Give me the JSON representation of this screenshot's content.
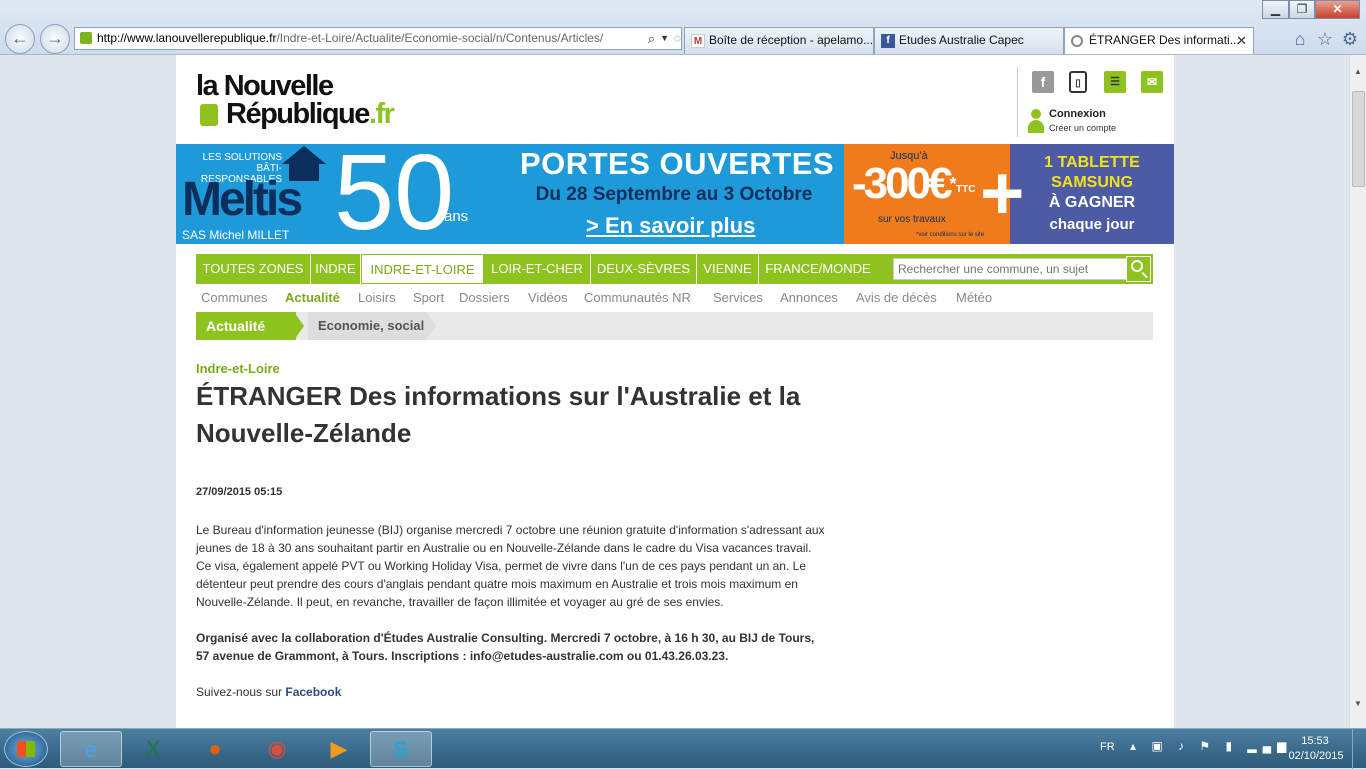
{
  "browser": {
    "address": {
      "host": "http://www.lanouvellerepublique.fr",
      "path": "/Indre-et-Loire/Actualite/Economie-social/n/Contenus/Articles/"
    },
    "tabs": [
      {
        "label": "Boîte de réception - apelamo...",
        "icon": "gmail-icon"
      },
      {
        "label": "Etudes Australie Capec",
        "icon": "facebook-icon"
      },
      {
        "label": "ÉTRANGER Des informati...",
        "icon": "loading-icon"
      }
    ],
    "close_glyph": "✕"
  },
  "header": {
    "logo_line1": "la Nouvelle",
    "logo_line2": "République",
    "logo_tld": ".fr",
    "login_label": "Connexion",
    "create_account_label": "Créer un compte"
  },
  "ad": {
    "tagline": "LES SOLUTIONS BÂTI-RESPONSABLES",
    "brand": "Meltis",
    "owner": "SAS Michel MILLET",
    "fifty": "50",
    "ans": "ans",
    "headline": "PORTES OUVERTES",
    "dates": "Du 28 Septembre au 3 Octobre",
    "more": "> En savoir plus",
    "jusqua": "Jusqu'à",
    "discount": "-300€",
    "discount_star": "*",
    "ttc": "TTC",
    "travaux": "sur vos travaux",
    "conditions": "*voir conditions sur le site",
    "plus": "+",
    "tablet_line1": "1 TABLETTE",
    "tablet_line2": "SAMSUNG",
    "tablet_line3": "À GAGNER",
    "tablet_line4": "chaque jour",
    "colors": {
      "blue": "#1e9ad9",
      "navy": "#0b2e5c",
      "orange": "#f07b1c",
      "purple": "#4c5ba3",
      "yellow": "#f5e11a"
    }
  },
  "region_nav": {
    "tabs": [
      "TOUTES ZONES",
      "INDRE",
      "INDRE-ET-LOIRE",
      "LOIR-ET-CHER",
      "DEUX-SÈVRES",
      "VIENNE",
      "FRANCE/MONDE"
    ],
    "active": "INDRE-ET-LOIRE",
    "search_placeholder": "Rechercher une commune, un sujet"
  },
  "section_nav": {
    "items": [
      "Communes",
      "Actualité",
      "Loisirs",
      "Sport",
      "Dossiers",
      "Vidéos",
      "Communautés NR",
      "Services",
      "Annonces",
      "Avis de décès",
      "Météo"
    ],
    "active": "Actualité"
  },
  "breadcrumb": {
    "current": "Actualité",
    "section": "Economie, social"
  },
  "article": {
    "region": "Indre-et-Loire",
    "title": "ÉTRANGER Des informations sur l'Australie et la Nouvelle-Zélande",
    "date": "27/09/2015 05:15",
    "body": "Le Bureau d'information jeunesse (BIJ) organise mercredi 7 octobre une réunion gratuite d'information s'adressant aux jeunes de 18 à 30 ans souhaitant partir en Australie ou en Nouvelle-Zélande dans le cadre du Visa vacances travail. Ce visa, également appelé PVT ou Working Holiday Visa, permet de vivre dans l'un de ces pays pendant un an. Le détenteur peut prendre des cours d'anglais pendant quatre mois maximum en Australie et trois mois maximum en Nouvelle-Zélande. Il peut, en revanche, travailler de façon illimitée et voyager au gré de ses envies.",
    "info": "Organisé avec la collaboration d'Études Australie Consulting. Mercredi 7 octobre, à 16 h 30, au BIJ de Tours, 57 avenue de Grammont, à Tours. Inscriptions : info@etudes-australie.com ou 01.43.26.03.23.",
    "follow_prefix": "Suivez-nous sur ",
    "follow_link": "Facebook"
  },
  "taskbar": {
    "lang": "FR",
    "time": "15:53",
    "date": "02/10/2015",
    "apps": [
      "internet-explorer",
      "excel",
      "firefox",
      "chrome",
      "media-player",
      "skype"
    ]
  },
  "theme": {
    "accent": "#8dc21f",
    "accent_text": "#7aa91a"
  }
}
